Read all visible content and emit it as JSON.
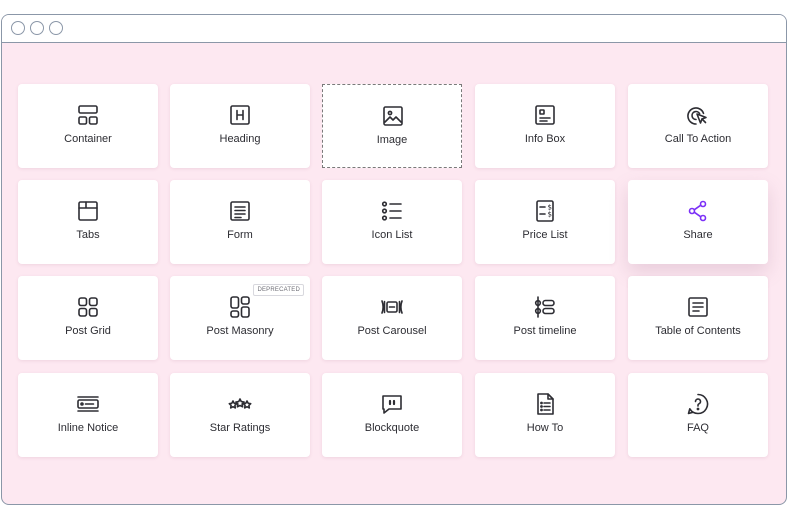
{
  "window": {
    "controls": [
      "close",
      "minimize",
      "maximize"
    ]
  },
  "widgets": [
    {
      "label": "Container",
      "icon": "container-icon"
    },
    {
      "label": "Heading",
      "icon": "heading-icon"
    },
    {
      "label": "Image",
      "icon": "image-icon",
      "selected": true
    },
    {
      "label": "Info Box",
      "icon": "info-box-icon"
    },
    {
      "label": "Call To Action",
      "icon": "call-to-action-icon"
    },
    {
      "label": "Tabs",
      "icon": "tabs-icon"
    },
    {
      "label": "Form",
      "icon": "form-icon"
    },
    {
      "label": "Icon List",
      "icon": "icon-list-icon"
    },
    {
      "label": "Price List",
      "icon": "price-list-icon"
    },
    {
      "label": "Share",
      "icon": "share-icon",
      "hovered": true
    },
    {
      "label": "Post Grid",
      "icon": "post-grid-icon"
    },
    {
      "label": "Post Masonry",
      "icon": "post-masonry-icon",
      "badge": "DEPRECATED"
    },
    {
      "label": "Post Carousel",
      "icon": "post-carousel-icon"
    },
    {
      "label": "Post timeline",
      "icon": "post-timeline-icon"
    },
    {
      "label": "Table of Contents",
      "icon": "table-of-contents-icon"
    },
    {
      "label": "Inline Notice",
      "icon": "inline-notice-icon"
    },
    {
      "label": "Star Ratings",
      "icon": "star-ratings-icon"
    },
    {
      "label": "Blockquote",
      "icon": "blockquote-icon"
    },
    {
      "label": "How To",
      "icon": "how-to-icon"
    },
    {
      "label": "FAQ",
      "icon": "faq-icon"
    }
  ],
  "colors": {
    "canvas": "#fde8f1",
    "card": "#ffffff",
    "icon": "#2d2d33",
    "accent": "#7b2ff7",
    "frame": "#8b97a8"
  }
}
